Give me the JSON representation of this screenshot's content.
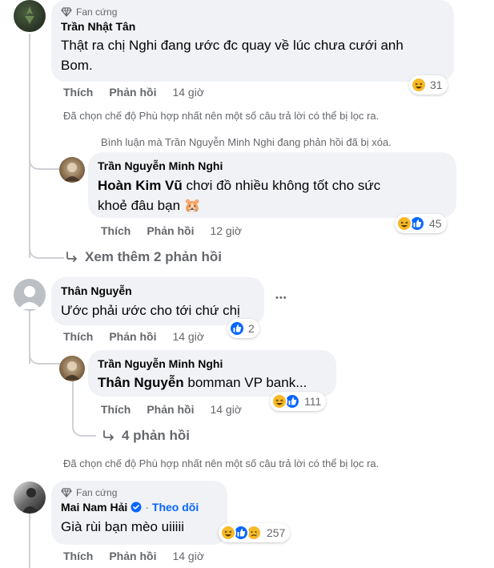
{
  "comments": [
    {
      "badge": "Fan cứng",
      "author": "Trần Nhật Tân",
      "text_line1": "Thật ra chị Nghi đang ước đc quay về lúc chưa cưới anh",
      "text_line2": "Bom.",
      "like_label": "Thích",
      "reply_label": "Phản hồi",
      "time": "14 giờ",
      "reaction_count": "31",
      "notice": "Đã chọn chế độ Phù hợp nhất nên một số câu trả lời có thể bị lọc ra."
    },
    {
      "deleted_notice": "Bình luận mà Trần Nguyễn Minh Nghi đang phản hồi đã bị xóa.",
      "author": "Trần Nguyễn Minh Nghi",
      "mention": "Hoàn Kim Vũ",
      "text_line1": " chơi đồ nhiều không tốt cho sức",
      "text_line2": "khoẻ đâu bạn 🐹",
      "like_label": "Thích",
      "reply_label": "Phản hồi",
      "time": "12 giờ",
      "reaction_count": "45",
      "see_more": "Xem thêm 2 phản hồi"
    },
    {
      "author": "Thân Nguyễn",
      "text": "Ước phải ước cho tới chứ chị",
      "more_label": "•••",
      "like_label": "Thích",
      "reply_label": "Phản hồi",
      "time": "14 giờ",
      "reaction_count": "2"
    },
    {
      "author": "Trần Nguyễn Minh Nghi",
      "mention": "Thân Nguyễn",
      "text": " bomman VP bank...",
      "like_label": "Thích",
      "reply_label": "Phản hồi",
      "time": "14 giờ",
      "reaction_count": "111",
      "replies_link": "4 phản hồi",
      "notice": "Đã chọn chế độ Phù hợp nhất nên một số câu trả lời có thể bị lọc ra."
    },
    {
      "badge": "Fan cứng",
      "author": "Mai Nam Hải",
      "follow": "Theo dõi",
      "text": "Già rùi bạn mèo uiiiii",
      "like_label": "Thích",
      "reply_label": "Phản hồi",
      "time": "14 giờ",
      "reaction_count": "257"
    }
  ],
  "colors": {
    "bubble": "#f0f2f5",
    "muted": "#65676b",
    "like_blue": "#0866ff",
    "haha_yellow": "#f7b928",
    "verified": "#0866ff"
  },
  "icons": [
    "diamond-icon",
    "verified-icon",
    "reply-arrow-icon",
    "haha-emoji-icon",
    "like-emoji-icon",
    "sad-emoji-icon",
    "more-icon"
  ]
}
